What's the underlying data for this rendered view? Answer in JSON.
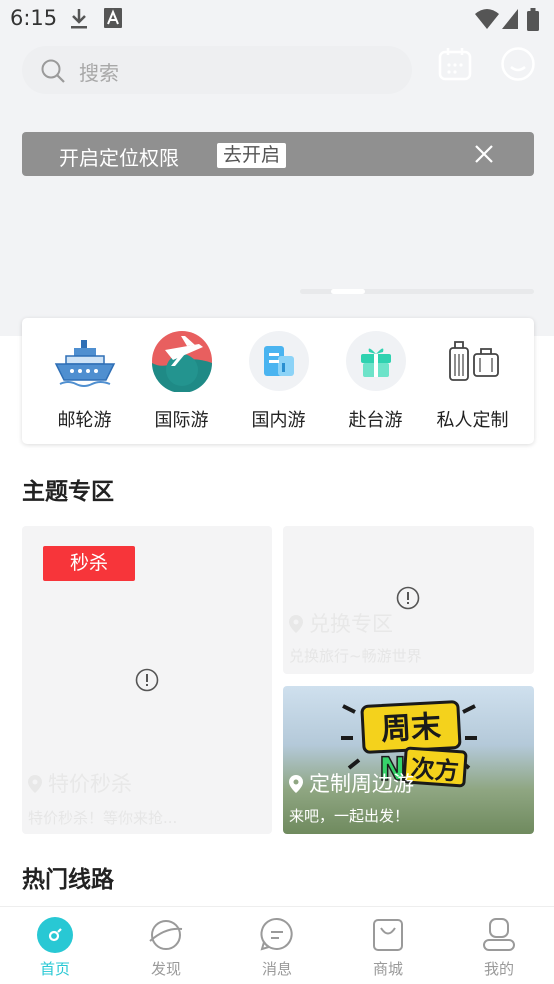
{
  "status_bar": {
    "time": "6:15",
    "icons": [
      "download-icon",
      "text-a-icon",
      "wifi-icon",
      "signal-icon",
      "battery-icon"
    ]
  },
  "search": {
    "placeholder": "搜索"
  },
  "top_actions": [
    "calendar-icon",
    "chat-bot-icon"
  ],
  "location_banner": {
    "text": "开启定位权限",
    "button": "去开启"
  },
  "categories": [
    {
      "label": "邮轮游",
      "icon": "cruise-ship-icon"
    },
    {
      "label": "国际游",
      "icon": "globe-plane-icon"
    },
    {
      "label": "国内游",
      "icon": "buildings-icon"
    },
    {
      "label": "赴台游",
      "icon": "gift-box-icon"
    },
    {
      "label": "私人定制",
      "icon": "luggage-icon"
    }
  ],
  "theme_section": {
    "title": "主题专区",
    "seckill": {
      "badge": "秒杀",
      "title": "特价秒杀",
      "subtitle": "特价秒杀！等你来抢..."
    },
    "exchange": {
      "title": "兑换专区",
      "subtitle": "兑换旅行~畅游世界"
    },
    "weekend": {
      "logo_text": "周末N次方",
      "title": "定制周边游",
      "subtitle": "来吧，一起出发！"
    }
  },
  "hot_routes": {
    "title": "热门线路"
  },
  "tabs": [
    {
      "label": "首页",
      "icon": "home-icon",
      "active": true
    },
    {
      "label": "发现",
      "icon": "planet-icon",
      "active": false
    },
    {
      "label": "消息",
      "icon": "message-icon",
      "active": false
    },
    {
      "label": "商城",
      "icon": "shopping-bag-icon",
      "active": false
    },
    {
      "label": "我的",
      "icon": "profile-icon",
      "active": false
    }
  ],
  "colors": {
    "accent": "#28c8d4",
    "seckill_red": "#f7353a",
    "banner_gray": "#909090"
  }
}
